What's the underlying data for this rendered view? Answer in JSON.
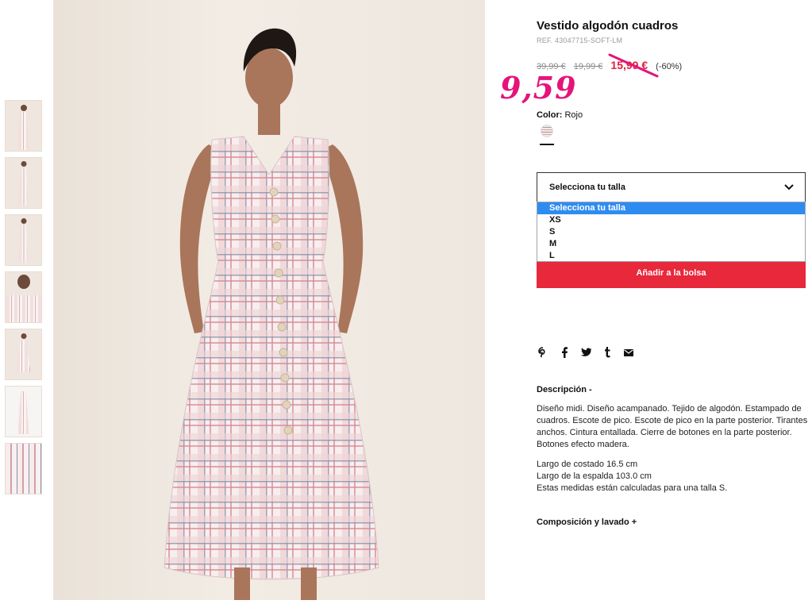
{
  "product": {
    "title": "Vestido algodón cuadros",
    "ref": "REF. 43047715-SOFT-LM",
    "price_original": "39,99 €",
    "price_previous": "19,99 €",
    "price_sale": "15,99 €",
    "discount": "(-60%)",
    "handwritten_price": "9,59",
    "color_label": "Color:",
    "color_value": "Rojo"
  },
  "size_select": {
    "selected": "Selecciona tu talla",
    "options": [
      "Selecciona tu talla",
      "XS",
      "S",
      "M",
      "L"
    ]
  },
  "add_to_bag_label": "Añadir a la bolsa",
  "social_icons": [
    "pinterest-icon",
    "facebook-icon",
    "twitter-icon",
    "tumblr-icon",
    "mail-icon"
  ],
  "description": {
    "heading": "Descripción -",
    "text": "Diseño midi. Diseño acampanado. Tejido de algodón. Estampado de cuadros. Escote de pico. Escote de pico en la parte posterior. Tirantes anchos. Cintura entallada. Cierre de botones en la parte posterior. Botones efecto madera.",
    "measure_1": "Largo de costado 16.5 cm",
    "measure_2": "Largo de la espalda 103.0 cm",
    "measure_3": "Estas medidas están calculadas para una talla S."
  },
  "composition_heading": "Composición y lavado +",
  "colors": {
    "sale": "#e0203b",
    "button": "#e8283b",
    "handwritten": "#e5147a",
    "dropdown_highlight": "#2e8cf0"
  }
}
